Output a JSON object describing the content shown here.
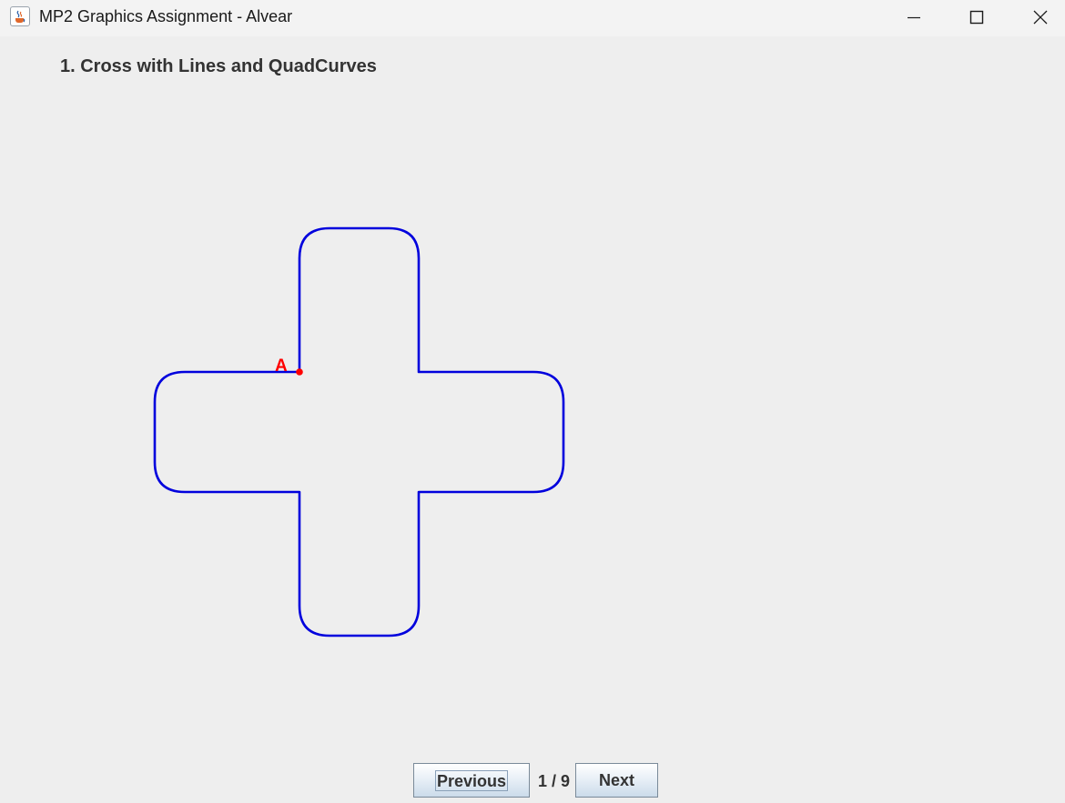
{
  "window": {
    "title": "MP2 Graphics Assignment - Alvear",
    "app_icon": "java-coffee-cup-icon",
    "controls": [
      "minimize-icon",
      "maximize-icon",
      "close-icon"
    ]
  },
  "page": {
    "heading": "1. Cross with Lines and QuadCurves",
    "point_label": "A",
    "shape_color": "#0000dd",
    "point_color": "#ff0000"
  },
  "navigation": {
    "previous_label": "Previous",
    "next_label": "Next",
    "page_indicator": "1 / 9",
    "current_page": 1,
    "total_pages": 9
  }
}
